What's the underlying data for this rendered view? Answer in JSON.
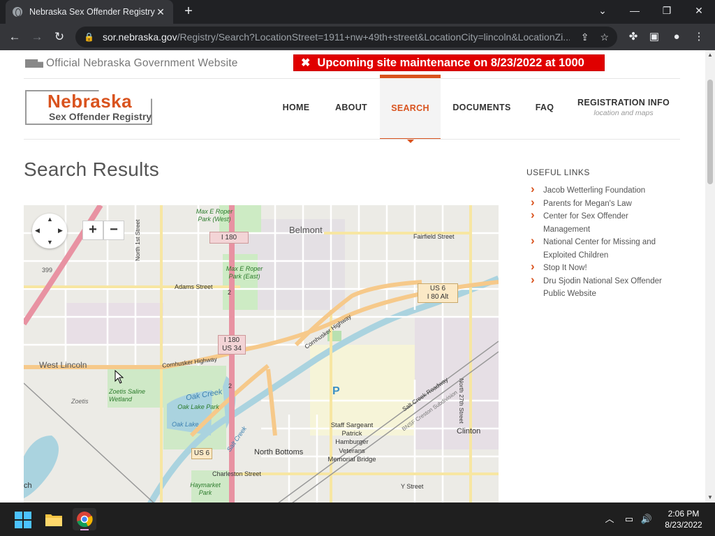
{
  "browser": {
    "tab_title": "Nebraska Sex Offender Registry:",
    "url_host": "sor.nebraska.gov",
    "url_path": "/Registry/Search?LocationStreet=1911+nw+49th+street&LocationCity=lincoln&LocationZi..."
  },
  "site": {
    "gov_banner": "Official Nebraska Government Website",
    "maintenance": "Upcoming site maintenance on 8/23/2022 at 1000",
    "logo_name": "Nebraska",
    "logo_sub": "Sex Offender Registry"
  },
  "nav": [
    {
      "label": "HOME"
    },
    {
      "label": "ABOUT"
    },
    {
      "label": "SEARCH"
    },
    {
      "label": "DOCUMENTS"
    },
    {
      "label": "FAQ"
    },
    {
      "label": "REGISTRATION INFO",
      "sub": "location and maps"
    }
  ],
  "main": {
    "title": "Search Results"
  },
  "map": {
    "zoom_in": "+",
    "zoom_out": "−",
    "labels": {
      "belmont": "Belmont",
      "west_lincoln": "West Lincoln",
      "north_bottoms": "North Bottoms",
      "clinton": "Clinton",
      "zoetis": "Zoetis",
      "zoetis_wetland": "Zoetis Saline Wetland",
      "oak_creek": "Oak Creek",
      "oak_lake_park": "Oak Lake Park",
      "oak_lake": "Oak Lake",
      "max_roper_west": "Max E Roper Park (West)",
      "max_roper_east": "Max E Roper Park (East)",
      "haymarket_park": "Haymarket Park",
      "memorial_bridge": "Staff Sargeant Patrick Hamburger Veterans Memorial Bridge",
      "adams_street": "Adams Street",
      "fairfield_street": "Fairfield Street",
      "charleston_street": "Charleston Street",
      "y_street": "Y Street",
      "north_1st": "North 1st Street",
      "north_27th": "North 27th Street",
      "cornhusker_hwy": "Cornhusker Highway",
      "salt_creek_roadway": "Salt Creek Roadway",
      "bnsf": "BNSF Creston Subdivision",
      "salt_creek": "Salt Creek",
      "i180": "I 180",
      "i180_us34": [
        "I 180",
        "US 34"
      ],
      "us6_i80alt": [
        "US 6",
        "I 80 Alt"
      ],
      "us6": "US 6",
      "r399": "399",
      "r2": "2",
      "parking": "P",
      "edge_ch": "ch"
    }
  },
  "useful_links": {
    "heading": "USEFUL LINKS",
    "items": [
      "Jacob Wetterling Foundation",
      "Parents for Megan's Law",
      "Center for Sex Offender Management",
      "National Center for Missing and Exploited Children",
      "Stop It Now!",
      "Dru Sjodin National Sex Offender Public Website"
    ]
  },
  "taskbar": {
    "time": "2:06 PM",
    "date": "8/23/2022"
  },
  "colors": {
    "accent": "#d9531e",
    "maintenance_bg": "#e00000"
  }
}
